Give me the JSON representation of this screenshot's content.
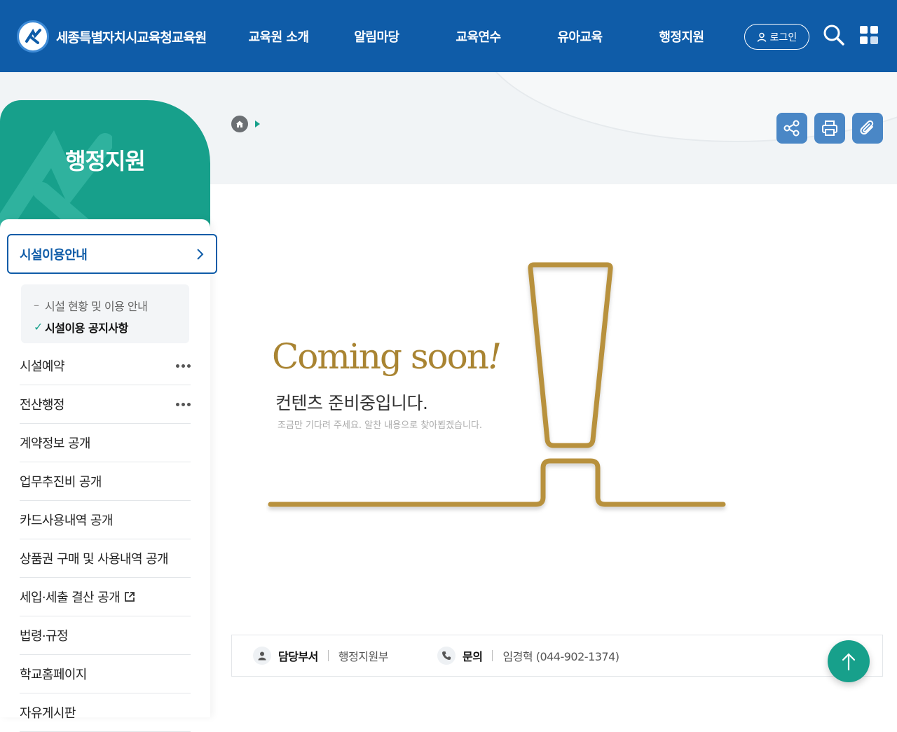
{
  "header": {
    "logo_text": "세종특별자치시교육청교육원",
    "nav": [
      "교육원 소개",
      "알림마당",
      "교육연수",
      "유아교육",
      "행정지원"
    ],
    "login_label": "로그인"
  },
  "lnb": {
    "title": "행정지원",
    "active_item": "시설이용안내",
    "sub_items": [
      {
        "marker": "–",
        "label": "시설 현황 및 이용 안내"
      },
      {
        "marker": "✓",
        "label": "시설이용 공지사항"
      }
    ],
    "items": [
      {
        "label": "시설예약",
        "has_more": true
      },
      {
        "label": "전산행정",
        "has_more": true
      },
      {
        "label": "계약정보 공개",
        "has_more": false
      },
      {
        "label": "업무추진비 공개",
        "has_more": false
      },
      {
        "label": "카드사용내역 공개",
        "has_more": false
      },
      {
        "label": "상품권 구매 및 사용내역 공개",
        "has_more": false
      },
      {
        "label": "세입·세출 결산 공개",
        "has_more": false,
        "external": true
      },
      {
        "label": "법령·규정",
        "has_more": false
      },
      {
        "label": "학교홈페이지",
        "has_more": false
      },
      {
        "label": "자유게시판",
        "has_more": false
      }
    ]
  },
  "content": {
    "coming_title": "Coming soon",
    "coming_mark": "!",
    "coming_ko": "컨텐츠 준비중입니다.",
    "coming_desc": "조금만 기다려 주세요. 알찬 내용으로 찾아뵙겠습니다."
  },
  "manager": {
    "dept_label": "담당부서",
    "dept_value": "행정지원부",
    "contact_label": "문의",
    "contact_value": "임경혁 (044-902-1374)"
  },
  "colors": {
    "header_bg": "#0f5ca8",
    "accent_teal": "#17a08b",
    "gold": "#b8913c",
    "tool_btn": "#4a87c6"
  },
  "icons": [
    "home-icon",
    "share-icon",
    "print-icon",
    "attach-icon",
    "search-icon",
    "grid-menu-icon",
    "user-icon",
    "phone-icon",
    "arrow-up-icon",
    "external-link-icon"
  ]
}
